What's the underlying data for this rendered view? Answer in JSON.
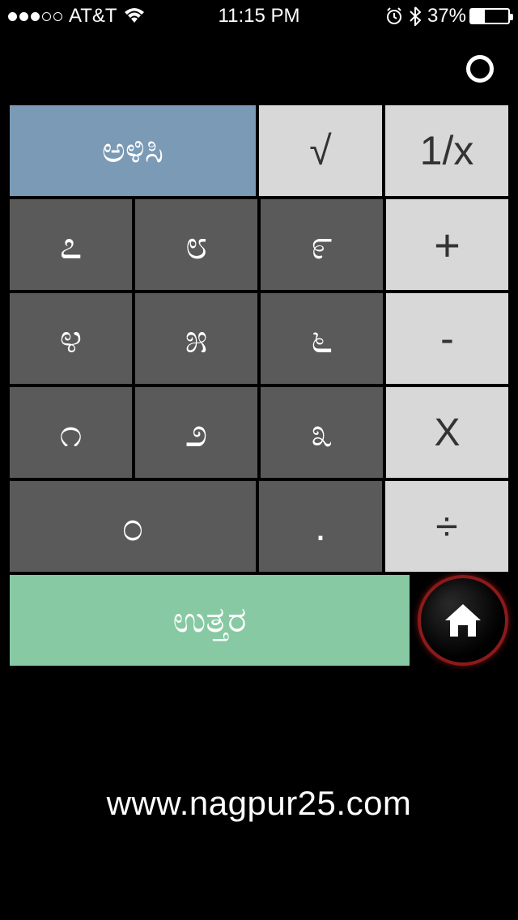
{
  "status": {
    "carrier": "AT&T",
    "time": "11:15 PM",
    "battery_pct": "37%"
  },
  "keys": {
    "clear": "ಅಳಿಸಿ",
    "sqrt": "√",
    "recip": "1/x",
    "n7": "೭",
    "n8": "೮",
    "n9": "೯",
    "plus": "+",
    "n4": "೪",
    "n5": "೫",
    "n6": "೬",
    "minus": "-",
    "n1": "೧",
    "n2": "೨",
    "n3": "೩",
    "mul": "X",
    "n0": "೦",
    "dot": ".",
    "div": "÷",
    "answer": "ಉತ್ತರ"
  },
  "footer": {
    "url": "www.nagpur25.com"
  }
}
